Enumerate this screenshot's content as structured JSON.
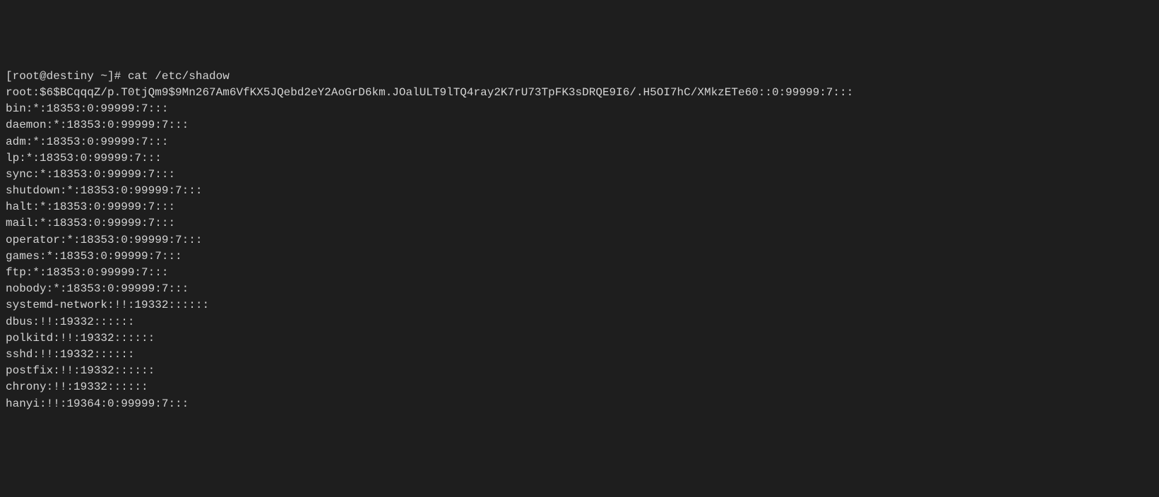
{
  "terminal": {
    "prompt": "[root@destiny ~]# ",
    "command": "cat /etc/shadow",
    "lines": [
      "root:$6$BCqqqZ/p.T0tjQm9$9Mn267Am6VfKX5JQebd2eY2AoGrD6km.JOalULT9lTQ4ray2K7rU73TpFK3sDRQE9I6/.H5OI7hC/XMkzETe60::0:99999:7:::",
      "bin:*:18353:0:99999:7:::",
      "daemon:*:18353:0:99999:7:::",
      "adm:*:18353:0:99999:7:::",
      "lp:*:18353:0:99999:7:::",
      "sync:*:18353:0:99999:7:::",
      "shutdown:*:18353:0:99999:7:::",
      "halt:*:18353:0:99999:7:::",
      "mail:*:18353:0:99999:7:::",
      "operator:*:18353:0:99999:7:::",
      "games:*:18353:0:99999:7:::",
      "ftp:*:18353:0:99999:7:::",
      "nobody:*:18353:0:99999:7:::",
      "systemd-network:!!:19332::::::",
      "dbus:!!:19332::::::",
      "polkitd:!!:19332::::::",
      "sshd:!!:19332::::::",
      "postfix:!!:19332::::::",
      "chrony:!!:19332::::::",
      "hanyi:!!:19364:0:99999:7:::"
    ]
  }
}
